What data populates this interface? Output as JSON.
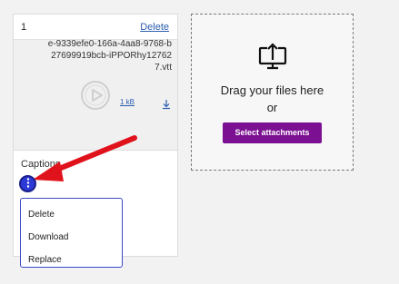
{
  "card": {
    "number": "1",
    "delete_label": "Delete",
    "captions_label": "Captions",
    "caption_filename": "sh…e-9339efe0-166a-4aa8-9768-b27699919bcb-il…127627.vtt",
    "caption_filename_display": "e-9339efe0-166a-4aa8-9768-b27699919bcb-iPPORhy127627.vtt",
    "caption_size": "1 kB"
  },
  "context_menu": {
    "items": [
      {
        "label": "Delete"
      },
      {
        "label": "Download"
      },
      {
        "label": "Replace"
      }
    ]
  },
  "dropzone": {
    "line1": "Drag your files here",
    "line2": "or",
    "button_label": "Select attachments"
  },
  "colors": {
    "accent_purple": "#7b1092",
    "kebab_blue": "#2b3ad6",
    "annotation_red": "#e0121b",
    "link_blue": "#2a5db0"
  },
  "icons": {
    "play": "play-circle-icon",
    "kebab": "kebab-menu-icon",
    "download": "download-icon",
    "upload": "upload-monitor-icon"
  }
}
